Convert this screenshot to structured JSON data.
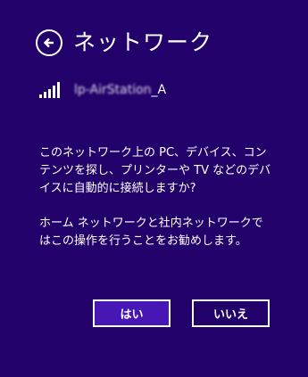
{
  "header": {
    "title": "ネットワーク",
    "back_icon": "back-arrow-icon"
  },
  "network": {
    "signal_icon": "wifi-signal-icon",
    "ssid_blurred": "lp-AirStation",
    "ssid_suffix": "_A"
  },
  "message": {
    "paragraph1": "このネットワーク上の PC、デバイス、コンテンツを探し、プリンターや TV などのデバイスに自動的に接続しますか?",
    "paragraph2": "ホーム ネットワークと社内ネットワークではこの操作を行うことをお勧めします。"
  },
  "buttons": {
    "yes_label": "はい",
    "no_label": "いいえ"
  },
  "colors": {
    "background": "#23016b",
    "primary_button": "#4617b4",
    "text": "#ffffff"
  }
}
